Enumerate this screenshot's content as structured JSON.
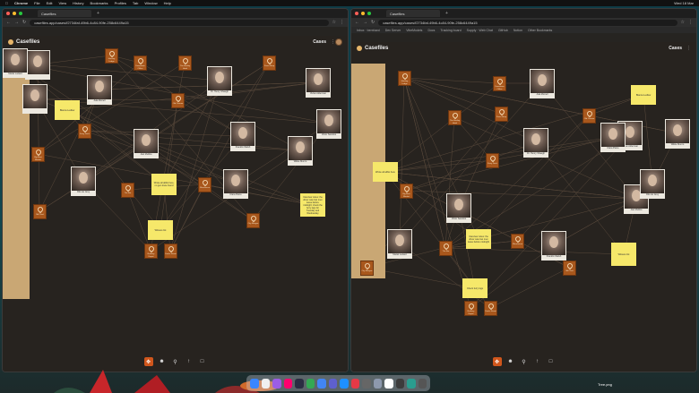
{
  "menubar": {
    "app": "Chrome",
    "items": [
      "File",
      "Edit",
      "View",
      "History",
      "Bookmarks",
      "Profiles",
      "Tab",
      "Window",
      "Help"
    ],
    "clock": "Wed 18 Mar"
  },
  "windows": [
    {
      "tab_title": "Casefiles",
      "url": "casefiles.app/cases/f2734faf-49b6-4c84-90fe-258c6449a15",
      "bookmarks": []
    },
    {
      "tab_title": "Casefiles",
      "url": "casefiles.app/cases/f2734faf-49b6-4c84-90fe-258c6449a15",
      "bookmarks": [
        "Inbox · bernhard",
        "Dev Server",
        "VibeModels",
        "Docs",
        "Tracking board",
        "Supply · Web Chat",
        "GitHub",
        "Notion",
        "Other Bookmarks"
      ]
    }
  ],
  "app": {
    "title": "Casefiles",
    "cases_label": "Cases"
  },
  "toolbar": {
    "tools": [
      "move-tool",
      "person-tool",
      "location-tool",
      "arrow-tool",
      "note-tool"
    ]
  },
  "board_left": {
    "persons": [
      "",
      "",
      "Ada Morrell",
      "Dr. Henry Shaugh",
      "Vivian Alderman",
      "Joel Mullins",
      "Franklin Walsh",
      "Wilkie Munro",
      "Victor Sandros",
      "Clara Pietre",
      "Otto de Grey",
      "Mariel Lazard"
    ],
    "locations": [
      "Hunting Lodge",
      "Downtown Office",
      "The Hartley Hotel",
      "Pawn Shop",
      "Old Cinema",
      "Ferry Dock",
      "Big Boat Market",
      "The Bar",
      "Warehouse",
      "Mill Yard",
      "City Morgue",
      "Railway Depot",
      "Docks Street"
    ],
    "notes": [
      "Blanca Ledlow",
      "Wrote all alibis here, no gun trace found",
      "Interview notes: the driver saw two men leave before midnight; check the ferry logs for Tuesday and Wednesday",
      "Witness list"
    ]
  },
  "board_right": {
    "persons": [
      "Ada Morrell",
      "Dr. Henry Shaugh",
      "Vivian Alderman",
      "Joel Mullins",
      "Franklin Walsh",
      "Wilkie Munro",
      "Victor Sandros",
      "Clara Pietre",
      "Otto de Grey",
      "Mariel Lazard"
    ],
    "locations": [
      "Hunting Lodge",
      "Downtown Office",
      "The Hartley Hotel",
      "Pawn Shop",
      "Old Cinema",
      "Ferry Dock",
      "Big Boat Market",
      "The Bar",
      "Warehouse",
      "Mill Yard",
      "City Morgue",
      "Railway Depot",
      "Docks Street"
    ],
    "notes": [
      "Blanca Ledlow",
      "Wrote all alibis here",
      "Interview notes: the driver saw two men leave before midnight",
      "Witness list",
      "Check ferry logs"
    ]
  },
  "dock_file_label": "Tree.png",
  "colors": {
    "board_bg": "#27231f",
    "location_card": "#a8571c",
    "note": "#f6e86a",
    "active_tool": "#d0561c"
  }
}
